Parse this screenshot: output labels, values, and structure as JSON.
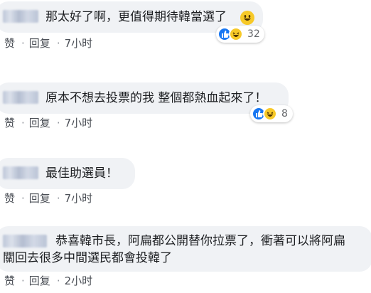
{
  "comments": [
    {
      "text": "那太好了啊，更值得期待韓當選了",
      "reaction_count": "32",
      "actions": {
        "like": "赞",
        "reply": "回复",
        "time": "7小时"
      }
    },
    {
      "text": "原本不想去投票的我 整個都熱血起來了！",
      "reaction_count": "8",
      "actions": {
        "like": "赞",
        "reply": "回复",
        "time": "7小时"
      }
    },
    {
      "text": "最佳助選員！",
      "actions": {
        "like": "赞",
        "reply": "回复",
        "time": "7小时"
      }
    },
    {
      "text_line1": "恭喜韓市長，阿扁都公開替你拉票了，衝著可以將阿扁",
      "text_line2": "關回去很多中間選民都會投韓了",
      "actions": {
        "like": "赞",
        "reply": "回复",
        "time": "2小时"
      }
    }
  ],
  "separator": "·",
  "colors": {
    "bubble": "#f0f2f5",
    "like_reaction": "#1877f2",
    "haha_reaction": "#f7c928"
  },
  "icons": [
    "smiley-emoji-icon",
    "like-reaction-icon",
    "haha-reaction-icon"
  ]
}
